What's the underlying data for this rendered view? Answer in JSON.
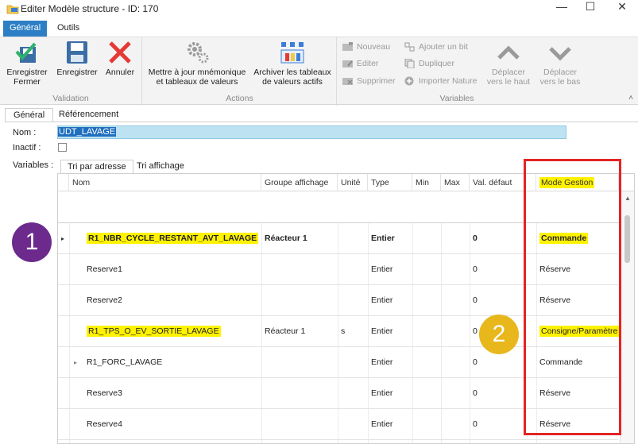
{
  "window": {
    "title": "Editer Modèle structure - ID: 170",
    "minimize": "—",
    "maximize": "☐",
    "close": "✕"
  },
  "ribbon_tabs": [
    "Général",
    "Outils"
  ],
  "ribbon": {
    "validation": {
      "label": "Validation",
      "save_close": "Enregistrer\nFermer",
      "save": "Enregistrer",
      "cancel": "Annuler"
    },
    "actions": {
      "label": "Actions",
      "update": "Mettre à jour mnémonique\net tableaux de valeurs",
      "archive": "Archiver les tableaux\nde valeurs actifs"
    },
    "variables": {
      "label": "Variables",
      "new": "Nouveau",
      "edit": "Editer",
      "delete": "Supprimer",
      "add_bit": "Ajouter un bit",
      "duplicate": "Dupliquer",
      "import_nature": "Importer Nature",
      "move_up": "Déplacer\nvers le haut",
      "move_down": "Déplacer\nvers le bas"
    },
    "collapse": "˄"
  },
  "page_tabs": [
    "Général",
    "Référencement"
  ],
  "form": {
    "name_label": "Nom :",
    "name_value": "UDT_LAVAGE",
    "inactive_label": "Inactif :",
    "variables_label": "Variables :"
  },
  "sub_tabs": [
    "Tri par adresse",
    "Tri affichage"
  ],
  "grid": {
    "columns": [
      "Nom",
      "Groupe affichage",
      "Unité",
      "Type",
      "Min",
      "Max",
      "Val. défaut",
      "Mode Gestion"
    ],
    "rows": [
      {
        "indicator": "▸",
        "nom": "R1_NBR_CYCLE_RESTANT_AVT_LAVAGE",
        "groupe": "Réacteur 1",
        "unite": "",
        "type": "Entier",
        "min": "",
        "max": "",
        "val": "0",
        "mode": "Commande"
      },
      {
        "indicator": "",
        "nom": "Reserve1",
        "groupe": "",
        "unite": "",
        "type": "Entier",
        "min": "",
        "max": "",
        "val": "0",
        "mode": "Réserve"
      },
      {
        "indicator": "",
        "nom": "Reserve2",
        "groupe": "",
        "unite": "",
        "type": "Entier",
        "min": "",
        "max": "",
        "val": "0",
        "mode": "Réserve"
      },
      {
        "indicator": "",
        "nom": "R1_TPS_O_EV_SORTIE_LAVAGE",
        "groupe": "Réacteur 1",
        "unite": "s",
        "type": "Entier",
        "min": "",
        "max": "",
        "val": "0",
        "mode": "Consigne/Paramètre"
      },
      {
        "indicator": "▸",
        "nom": "R1_FORC_LAVAGE",
        "groupe": "",
        "unite": "",
        "type": "Entier",
        "min": "",
        "max": "",
        "val": "0",
        "mode": "Commande"
      },
      {
        "indicator": "",
        "nom": "Reserve3",
        "groupe": "",
        "unite": "",
        "type": "Entier",
        "min": "",
        "max": "",
        "val": "0",
        "mode": "Réserve"
      },
      {
        "indicator": "",
        "nom": "Reserve4",
        "groupe": "",
        "unite": "",
        "type": "Entier",
        "min": "",
        "max": "",
        "val": "0",
        "mode": "Réserve"
      }
    ]
  },
  "annotations": {
    "badge1": "1",
    "badge2": "2"
  },
  "colors": {
    "accent": "#2c7fc4",
    "highlight": "#fff200",
    "annotation_red": "#e32424",
    "badge1": "#6b2a8c",
    "badge2": "#e7b71c"
  }
}
